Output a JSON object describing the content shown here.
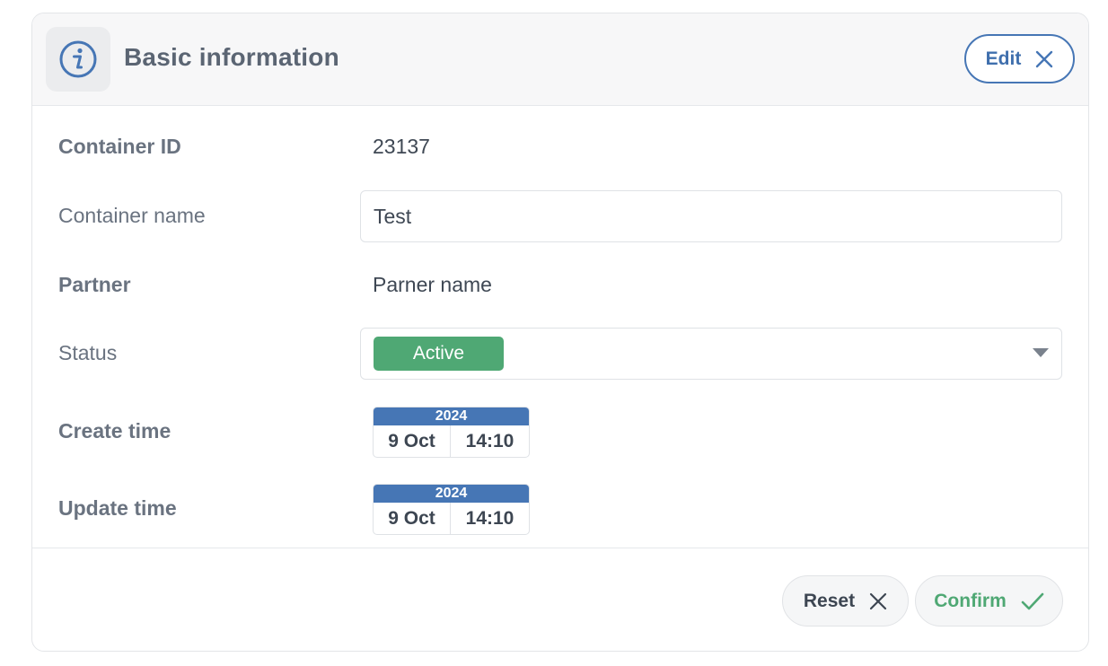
{
  "header": {
    "title": "Basic information",
    "edit_label": "Edit",
    "icon": "info-icon"
  },
  "fields": {
    "container_id": {
      "label": "Container ID",
      "value": "23137"
    },
    "container_name": {
      "label": "Container name",
      "value": "Test"
    },
    "partner": {
      "label": "Partner",
      "value": "Parner name"
    },
    "status": {
      "label": "Status",
      "value": "Active"
    },
    "create_time": {
      "label": "Create time",
      "year": "2024",
      "day": "9 Oct",
      "time": "14:10"
    },
    "update_time": {
      "label": "Update time",
      "year": "2024",
      "day": "9 Oct",
      "time": "14:10"
    }
  },
  "footer": {
    "reset_label": "Reset",
    "confirm_label": "Confirm"
  },
  "colors": {
    "accent_blue": "#4676b5",
    "status_active": "#4fa874",
    "confirm_green": "#4fa874"
  }
}
